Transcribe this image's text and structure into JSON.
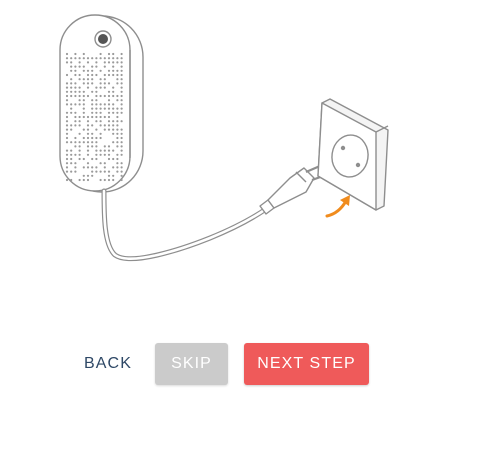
{
  "illustration": {
    "device": "device-icon",
    "plug": "plug-icon",
    "socket": "socket-icon",
    "arrow": "insert-arrow-icon",
    "accent_color": "#f08c1e",
    "line_color": "#9a9a9a"
  },
  "buttons": {
    "back_label": "BACK",
    "skip_label": "SKIP",
    "next_label": "NEXT STEP",
    "skip_color": "#cbcbcb",
    "next_color": "#ef5a5a",
    "back_color": "#2e4866"
  }
}
